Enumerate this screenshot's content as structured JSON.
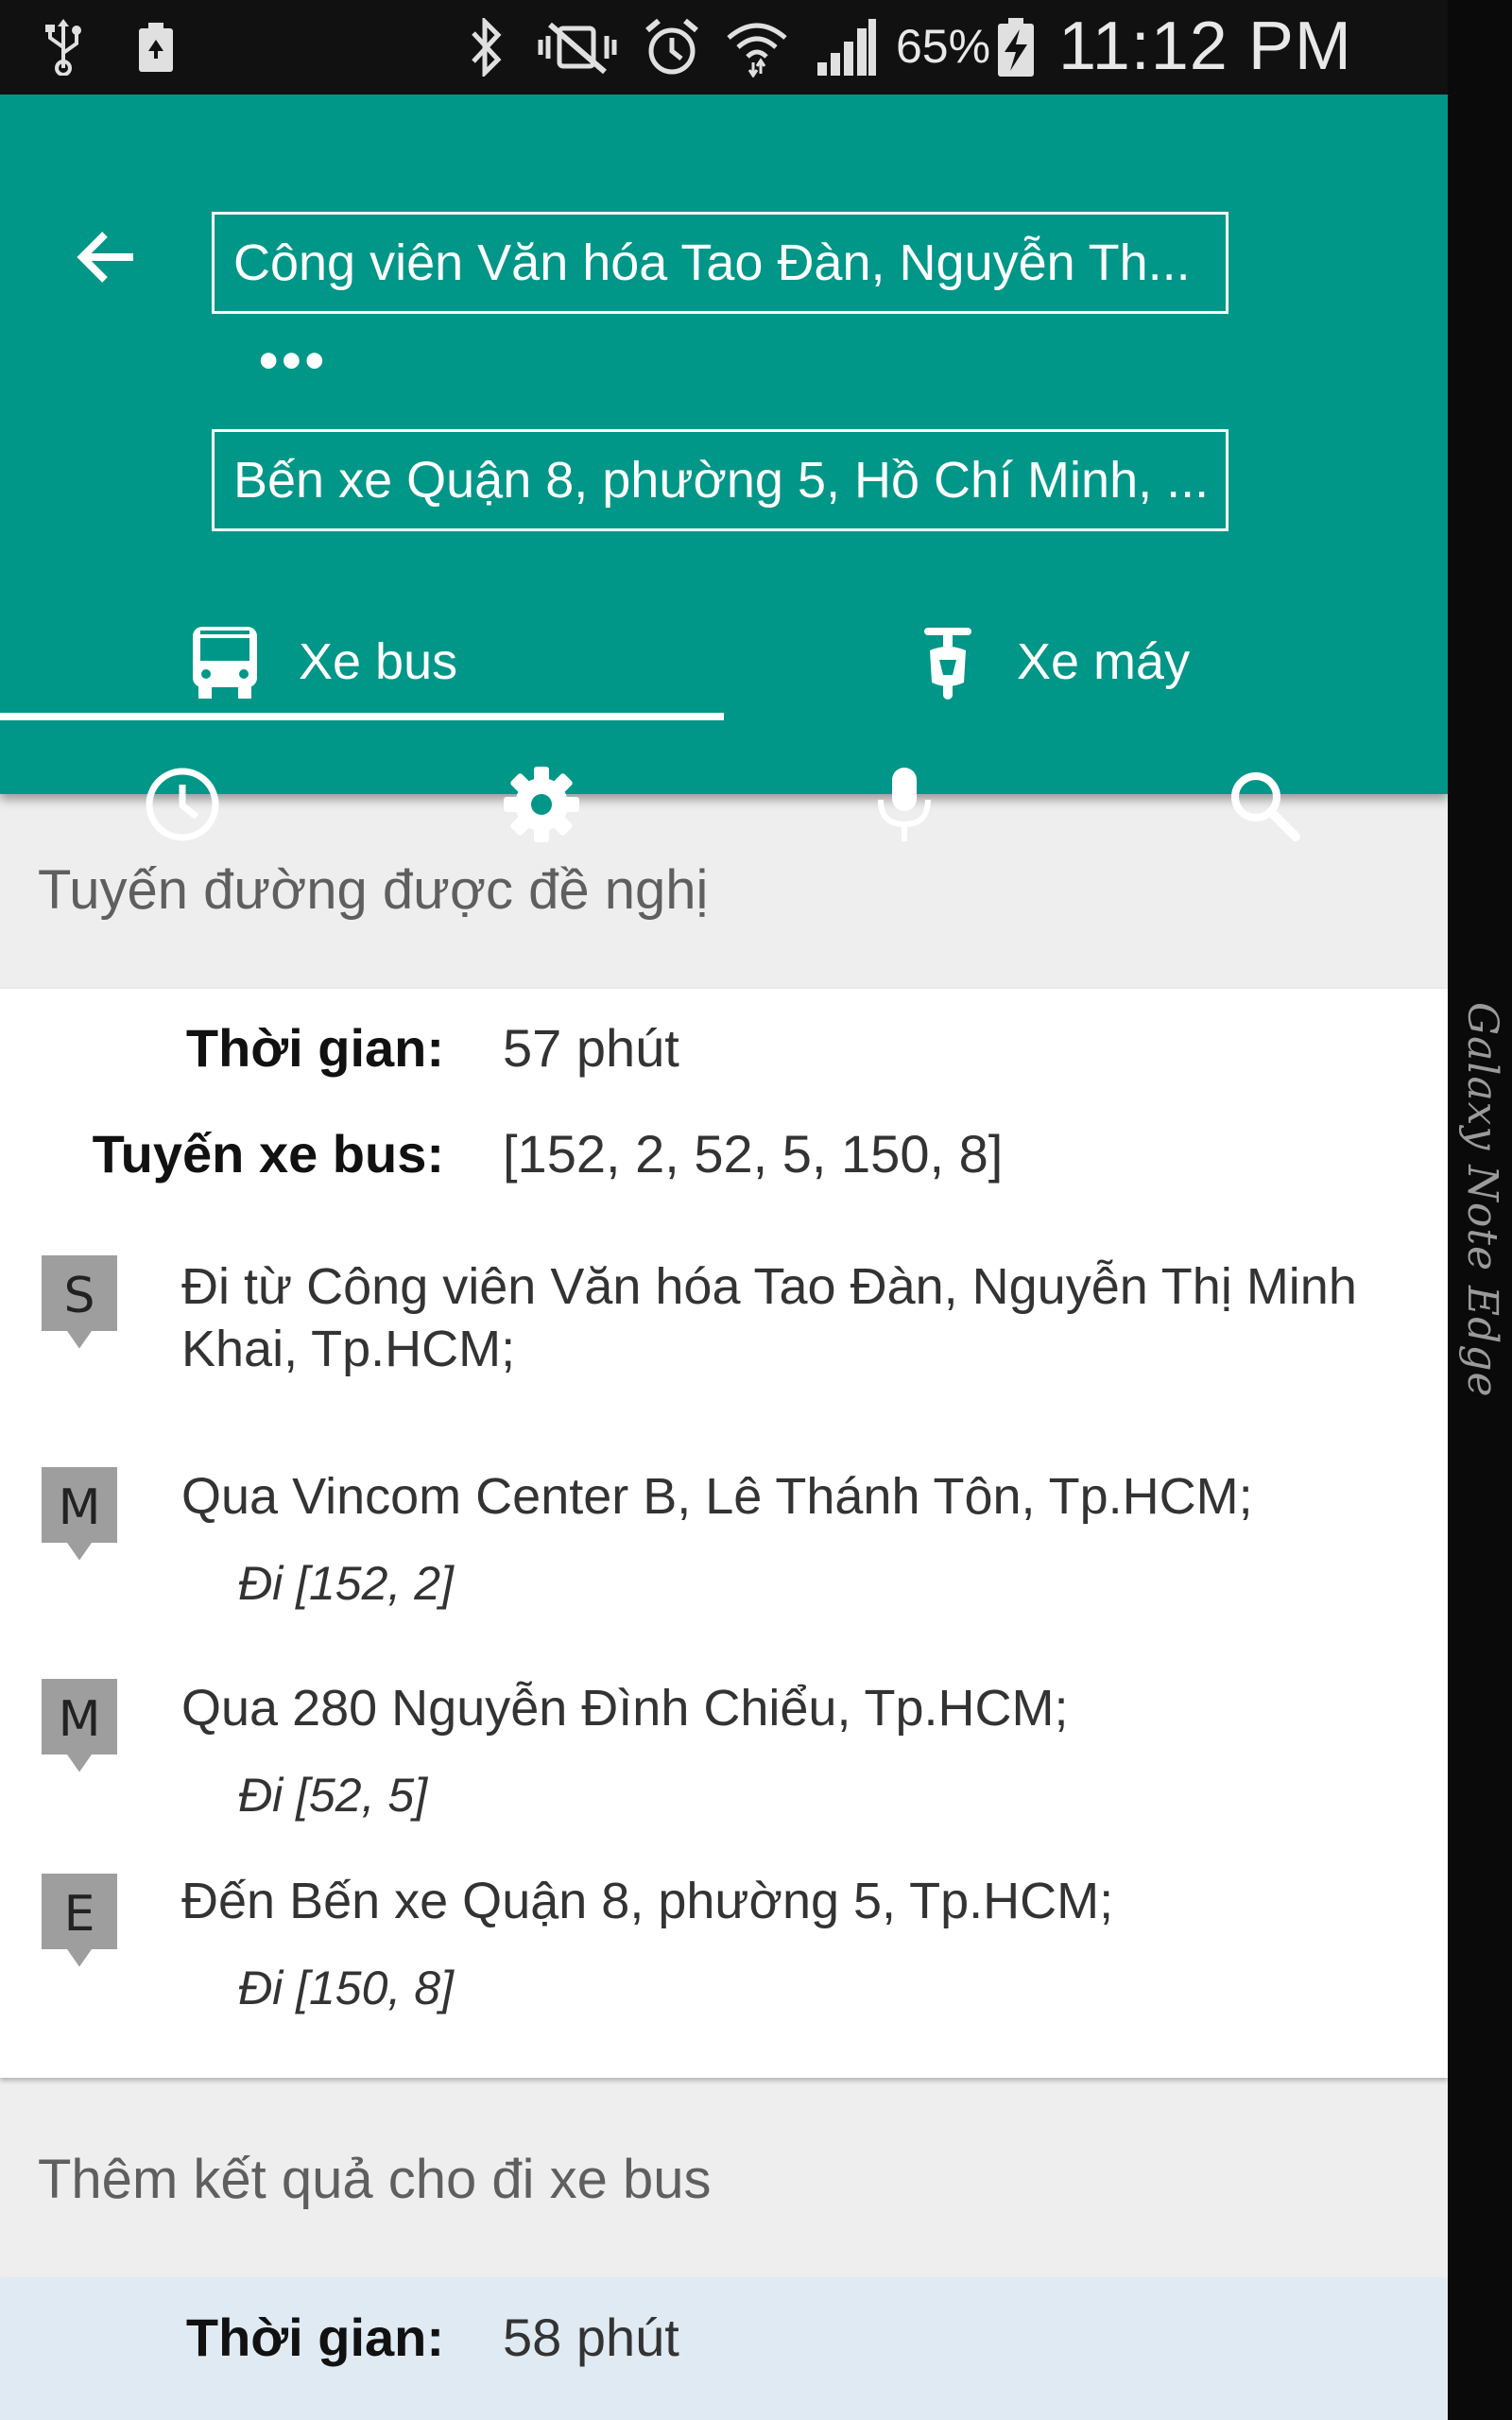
{
  "status_bar": {
    "battery_percent": "65%",
    "time": "11:12 PM",
    "icons": [
      "usb-icon",
      "recycle-notification-icon",
      "bluetooth-icon",
      "vibrate-mute-icon",
      "alarm-icon",
      "wifi-icon",
      "signal-icon",
      "battery-charging-icon"
    ]
  },
  "header": {
    "back_icon": "arrow-left-icon",
    "from_value": "Công viên Văn hóa Tao Đàn, Nguyễn Th...",
    "waypoints_icon": "•••",
    "to_value": "Bến xe Quận 8, phường 5, Hồ Chí Minh, ...",
    "tabs": [
      {
        "label": "Xe bus",
        "icon": "bus-icon",
        "selected": true
      },
      {
        "label": "Xe máy",
        "icon": "scooter-icon",
        "selected": false
      }
    ],
    "tools": [
      "history-clock-icon",
      "settings-gear-icon",
      "microphone-icon",
      "search-icon"
    ],
    "accent_color": "#009688"
  },
  "suggested": {
    "title": "Tuyến đường được đề nghị",
    "time_label": "Thời gian:",
    "time_value": "57 phút",
    "routes_label": "Tuyến xe bus:",
    "routes_value": "[152, 2, 52, 5, 150, 8]",
    "steps": [
      {
        "marker": "S",
        "text": "Đi từ Công viên Văn hóa Tao Đàn, Nguyễn Thị Minh Khai, Tp.HCM;",
        "sub": ""
      },
      {
        "marker": "M",
        "text": "Qua Vincom Center B, Lê Thánh Tôn, Tp.HCM;",
        "sub": "Đi [152, 2]"
      },
      {
        "marker": "M",
        "text": "Qua 280 Nguyễn Đình Chiểu, Tp.HCM;",
        "sub": "Đi [52, 5]"
      },
      {
        "marker": "E",
        "text": "Đến Bến xe Quận 8, phường 5, Tp.HCM;",
        "sub": "Đi [150, 8]"
      }
    ]
  },
  "more_results": {
    "title": "Thêm kết quả cho đi xe bus",
    "time_label": "Thời gian:",
    "time_value": "58 phút"
  },
  "device_edge_label": "Galaxy Note Edge"
}
